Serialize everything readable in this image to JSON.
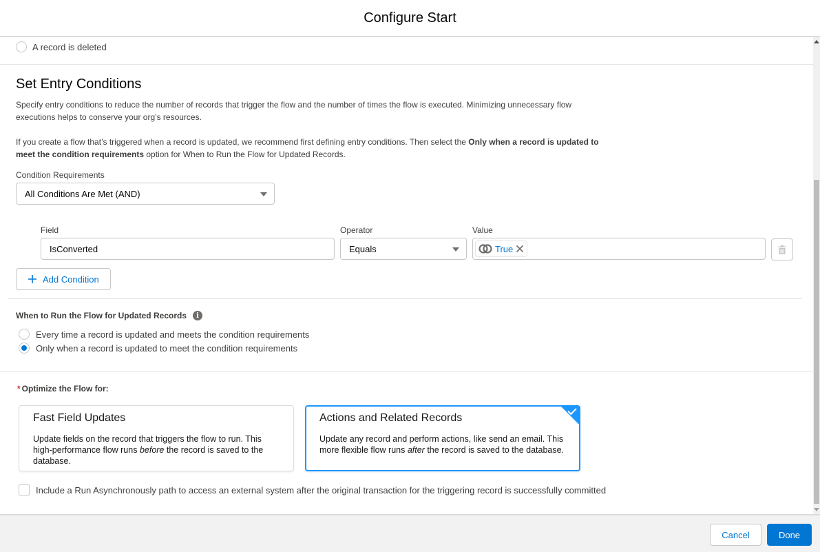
{
  "header": {
    "title": "Configure Start"
  },
  "trigger_options": {
    "deleted_label": "A record is deleted"
  },
  "entry_conditions": {
    "title": "Set Entry Conditions",
    "description": "Specify entry conditions to reduce the number of records that trigger the flow and the number of times the flow is executed. Minimizing unnecessary flow executions helps to conserve your org’s resources.",
    "recommendation_pre": "If you create a flow that’s triggered when a record is updated, we recommend first defining entry conditions. Then select the ",
    "recommendation_bold": "Only when a record is updated to meet the condition requirements",
    "recommendation_post": " option for When to Run the Flow for Updated Records.",
    "requirements_label": "Condition Requirements",
    "requirements_value": "All Conditions Are Met (AND)",
    "conditions": [
      {
        "field_label": "Field",
        "field_value": "IsConverted",
        "operator_label": "Operator",
        "operator_value": "Equals",
        "value_label": "Value",
        "value_pill": "True"
      }
    ],
    "add_condition_label": "Add Condition"
  },
  "when_to_run": {
    "title": "When to Run the Flow for Updated Records",
    "options": [
      {
        "label": "Every time a record is updated and meets the condition requirements",
        "selected": false
      },
      {
        "label": "Only when a record is updated to meet the condition requirements",
        "selected": true
      }
    ]
  },
  "optimize": {
    "required_marker": "*",
    "title": "Optimize the Flow for:",
    "cards": [
      {
        "title": "Fast Field Updates",
        "body_pre": "Update fields on the record that triggers the flow to run. This high-performance flow runs ",
        "body_em": "before",
        "body_post": " the record is saved to the database.",
        "selected": false
      },
      {
        "title": "Actions and Related Records",
        "body_pre": "Update any record and perform actions, like send an email. This more flexible flow runs ",
        "body_em": "after",
        "body_post": " the record is saved to the database.",
        "selected": true
      }
    ],
    "async_label": "Include a Run Asynchronously path to access an external system after the original transaction for the triggering record is successfully committed",
    "async_checked": false
  },
  "footer": {
    "cancel_label": "Cancel",
    "done_label": "Done"
  },
  "colors": {
    "brand": "#0176d3",
    "selected_border": "#1b96ff",
    "required": "#c23934"
  }
}
